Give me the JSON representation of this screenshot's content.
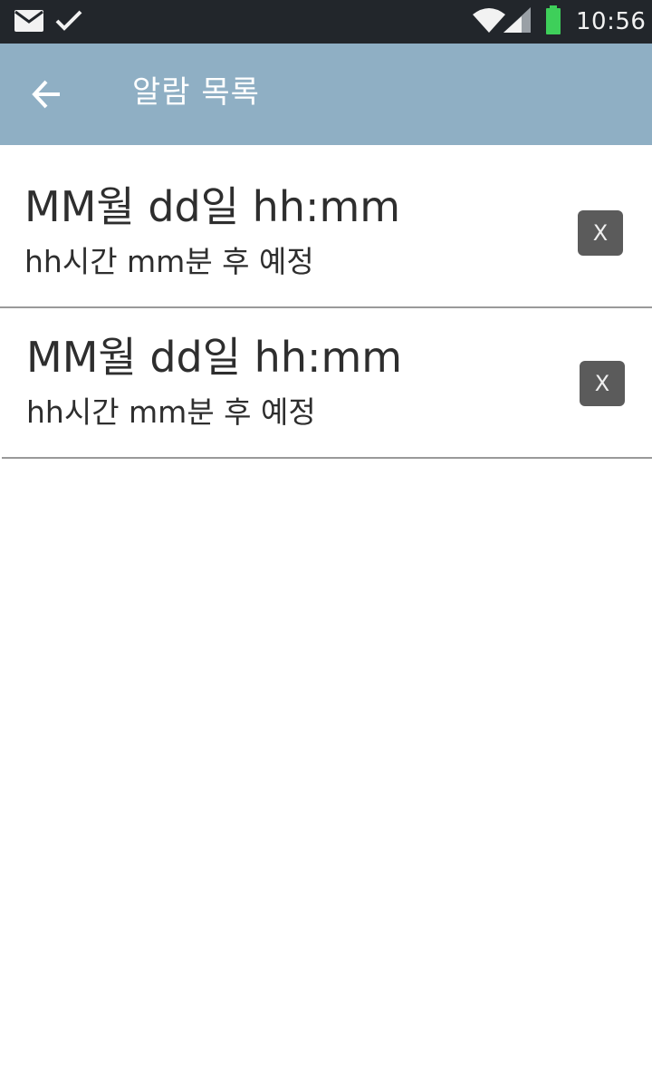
{
  "status_bar": {
    "time": "10:56",
    "battery_color": "#3ecf5a",
    "icons": [
      "mail-icon",
      "check-icon",
      "wifi-icon",
      "cellular-signal-icon",
      "battery-icon"
    ]
  },
  "app_bar": {
    "title": "알람 목록",
    "back_icon": "back-arrow-icon",
    "background_color": "#8fafc4"
  },
  "alarms": [
    {
      "datetime": "MM월 dd일 hh:mm",
      "remaining": "hh시간 mm분 후 예정",
      "delete_label": "X"
    },
    {
      "datetime": "MM월 dd일 hh:mm",
      "remaining": "hh시간 mm분 후 예정",
      "delete_label": "X"
    }
  ]
}
